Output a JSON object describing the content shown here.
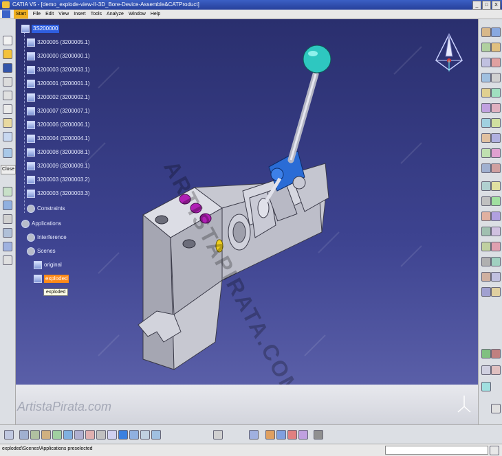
{
  "window": {
    "title": "CATIA V5 - [demo_explode-view-II-3D_Bore-Device-Assemble&CATProduct]",
    "controls": [
      "_",
      "□",
      "X"
    ]
  },
  "menubar": {
    "items": [
      "Start",
      "File",
      "Edit",
      "View",
      "Insert",
      "Tools",
      "Analyze",
      "Window",
      "Help"
    ]
  },
  "tree": {
    "root": "3S200000",
    "parts": [
      "3200005 (3200005.1)",
      "3200000 (3200000.1)",
      "3200003 (3200003.1)",
      "3200001 (3200001.1)",
      "3200002 (3200002.1)",
      "3200007 (3200007.1)",
      "3200006 (3200006.1)",
      "3200004 (3200004.1)",
      "3200008 (3200008.1)",
      "3200009 (3200009.1)",
      "3200003 (3200003.2)",
      "3200003 (3200003.3)"
    ],
    "constraints": "Constraints",
    "applications": "Applications",
    "interference": "Interference",
    "scenes": "Scenes",
    "original": "original",
    "exploded": "exploded"
  },
  "tooltip": "exploded",
  "left_toolbar": {
    "close_label": "Close"
  },
  "viewport": {
    "watermark": "ARTISTAPIRATA.COM",
    "brand": "ArtistaPirata.com"
  },
  "status": {
    "text": "exploded\\Scenes\\Applications preselected"
  },
  "colors": {
    "viewport_top": "#2a2f6e",
    "viewport_bottom": "#5a5fa8",
    "selection": "#2e5ee0",
    "exploded_highlight": "#ff8a1a",
    "knob": "#2ec7c0",
    "joint_blue": "#2a6cd6",
    "bolts": "#b01fb5",
    "body_gray": "#c9cad3"
  }
}
